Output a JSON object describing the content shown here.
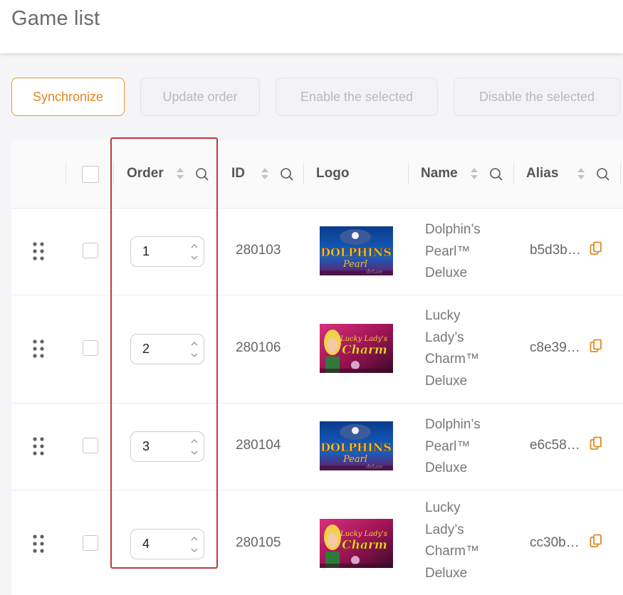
{
  "header": {
    "title": "Game list"
  },
  "toolbar": {
    "synchronize_label": "Synchronize",
    "update_order_label": "Update order",
    "enable_selected_label": "Enable the selected",
    "disable_selected_label": "Disable the selected"
  },
  "table": {
    "columns": {
      "order": "Order",
      "id": "ID",
      "logo": "Logo",
      "name": "Name",
      "alias": "Alias"
    },
    "rows": [
      {
        "order": "1",
        "id": "280103",
        "name": [
          "Dolphin’s",
          "Pearl™",
          "Deluxe"
        ],
        "alias": "b5d3b…",
        "logo": "dolphins-pearl-deluxe"
      },
      {
        "order": "2",
        "id": "280106",
        "name": [
          "Lucky",
          "Lady’s",
          "Charm™",
          "Deluxe"
        ],
        "alias": "c8e39…",
        "logo": "lucky-ladys-charm-deluxe"
      },
      {
        "order": "3",
        "id": "280104",
        "name": [
          "Dolphin’s",
          "Pearl™",
          "Deluxe"
        ],
        "alias": "e6c58…",
        "logo": "dolphins-pearl-deluxe"
      },
      {
        "order": "4",
        "id": "280105",
        "name": [
          "Lucky",
          "Lady’s",
          "Charm™",
          "Deluxe"
        ],
        "alias": "cc30b…",
        "logo": "lucky-ladys-charm-deluxe"
      }
    ]
  },
  "colors": {
    "accent": "#e8932f",
    "highlight": "#c4373c",
    "disabled_text": "#b9b9be"
  },
  "logos": {
    "dolphins-pearl-deluxe": {
      "line1": "DOLPHINS",
      "line2": "Pearl",
      "line3": "deluxe"
    },
    "lucky-ladys-charm-deluxe": {
      "line1": "Lucky Lady's",
      "line2": "Charm",
      "line3": "deluxe"
    }
  }
}
